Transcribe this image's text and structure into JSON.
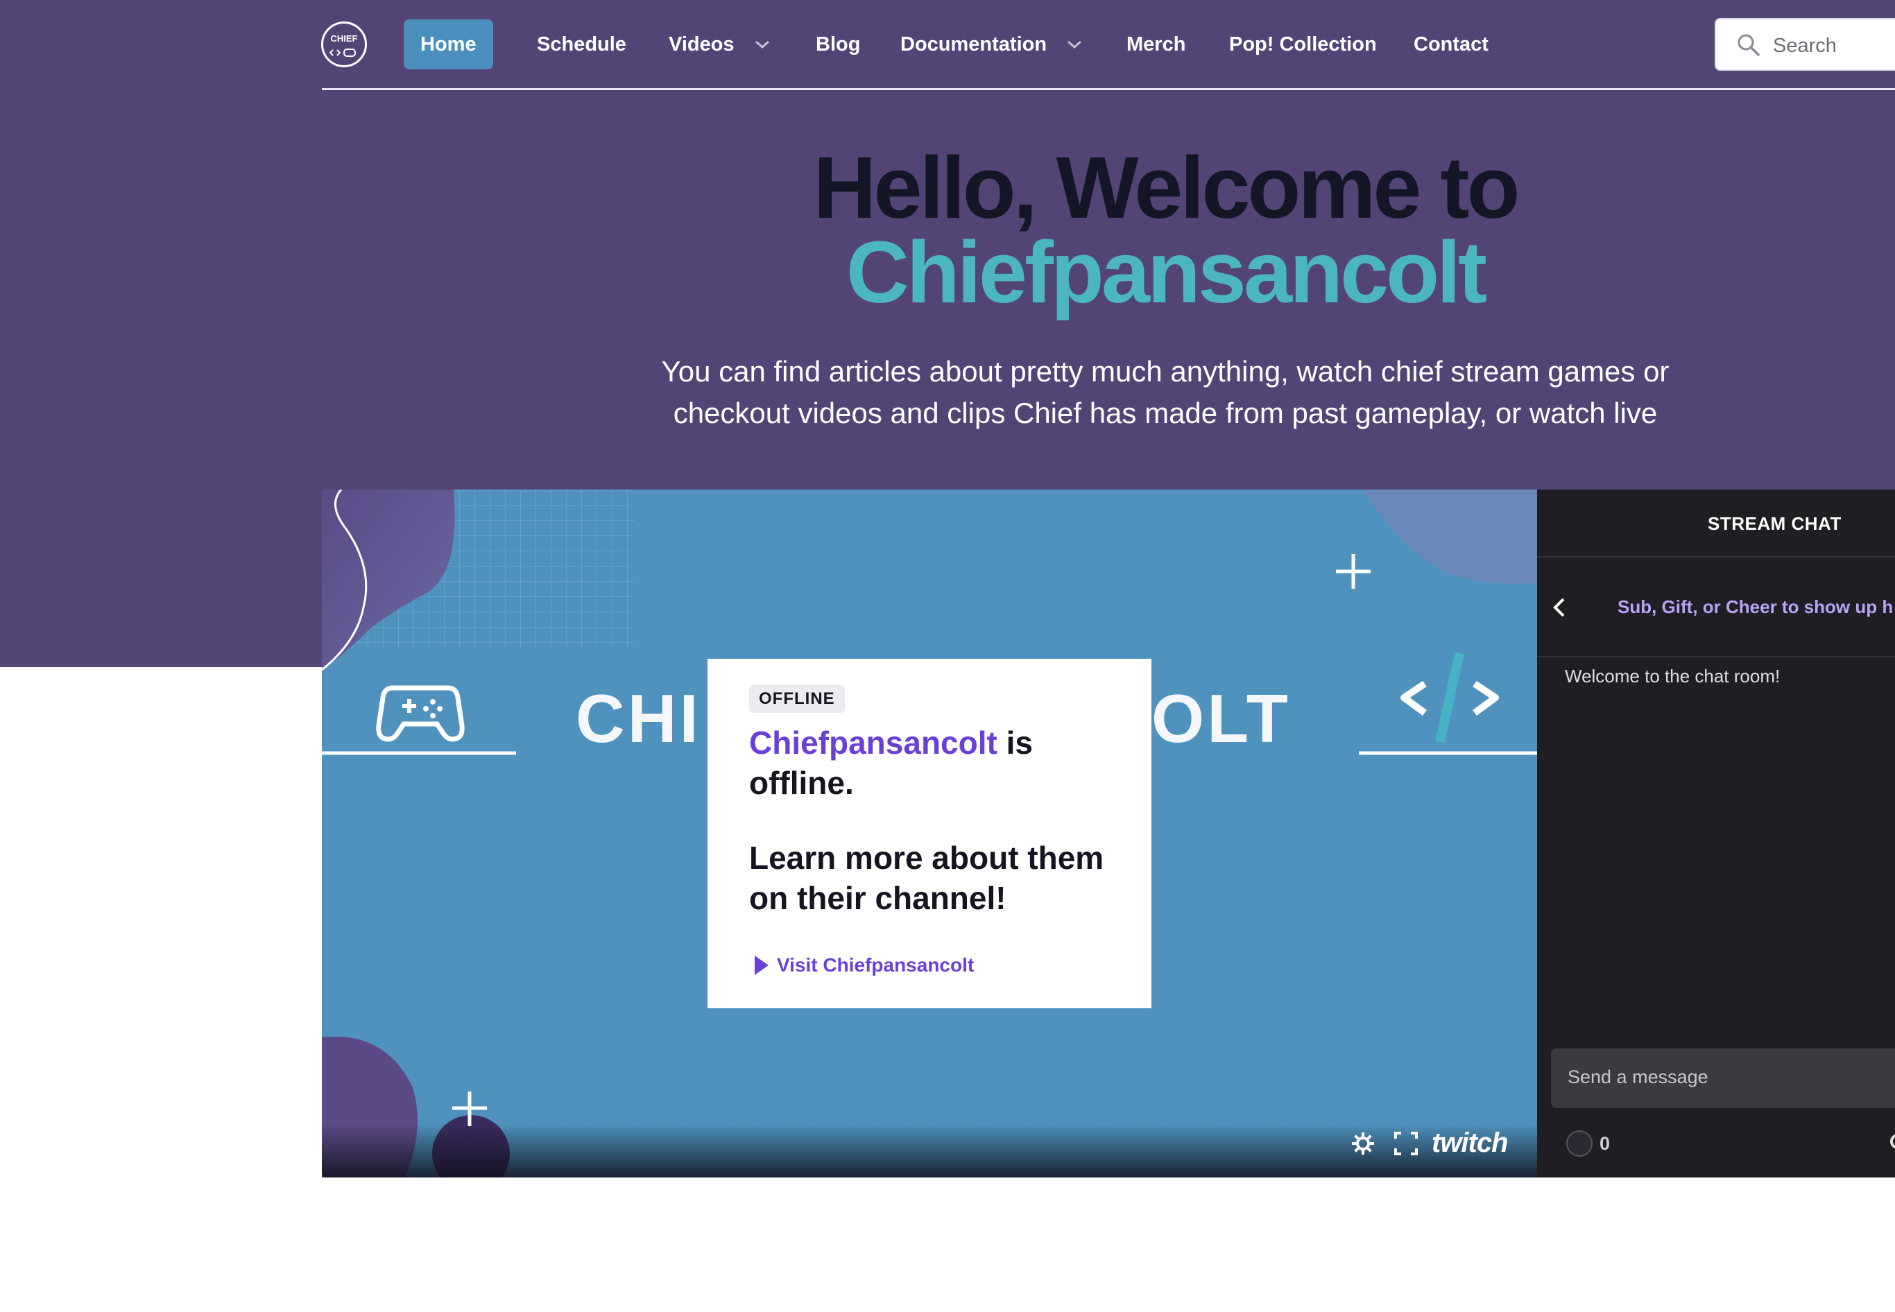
{
  "nav": {
    "logo_text": "CHIEF",
    "items": [
      {
        "label": "Home",
        "active": true
      },
      {
        "label": "Schedule"
      },
      {
        "label": "Videos",
        "dropdown": true
      },
      {
        "label": "Blog"
      },
      {
        "label": "Documentation",
        "dropdown": true
      },
      {
        "label": "Merch"
      },
      {
        "label": "Pop! Collection"
      },
      {
        "label": "Contact"
      }
    ],
    "search_placeholder": "Search"
  },
  "hero": {
    "headline_line1": "Hello, Welcome to",
    "headline_line2": "Chiefpansancolt",
    "subtitle": "You can find articles about pretty much anything, watch chief stream games or checkout videos and clips Chief has made from past gameplay, or watch live"
  },
  "player": {
    "banner_left": "CHI",
    "banner_right": "OLT",
    "offline_badge": "OFFLINE",
    "channel_name": "Chiefpansancolt",
    "offline_suffix": " is offline.",
    "learn_more": "Learn more about them on their channel!",
    "visit_link": "Visit Chiefpansancolt",
    "brand": "twitch"
  },
  "chat": {
    "title": "STREAM CHAT",
    "banner": "Sub, Gift, or Cheer to show up h",
    "welcome": "Welcome to the chat room!",
    "input_placeholder": "Send a message",
    "points": "0"
  },
  "colors": {
    "hero_bg": "#524576",
    "accent_teal": "#4bb5c1",
    "nav_active": "#4a8fbe",
    "player_bg": "#4e92bd",
    "twitch_purple": "#6a3fd8",
    "chat_bg": "#1f1f23"
  },
  "icons": {
    "search": "search-icon",
    "chevron": "chevron-down-icon",
    "gear": "gear-icon",
    "fullscreen": "fullscreen-icon",
    "gamepad": "gamepad-icon",
    "code": "code-icon"
  }
}
